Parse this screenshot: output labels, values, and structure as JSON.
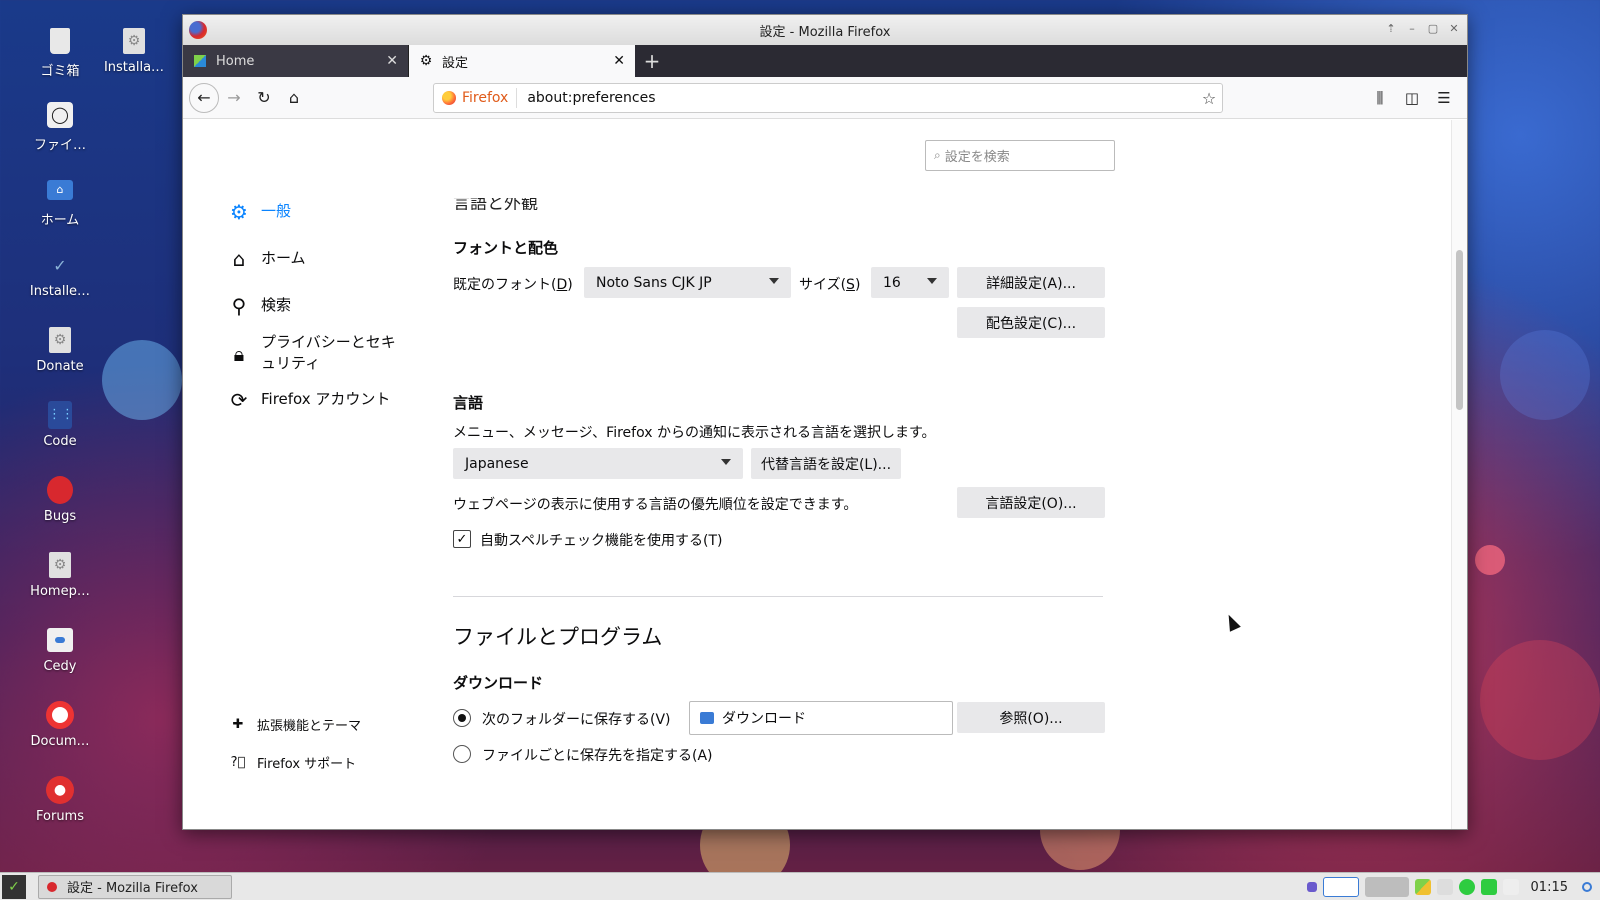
{
  "desktop": {
    "icons": [
      {
        "label": "ゴミ箱"
      },
      {
        "label": "Installa…"
      },
      {
        "label": "ファイ…"
      },
      {
        "label": "ホーム"
      },
      {
        "label": "Installe…"
      },
      {
        "label": "Donate"
      },
      {
        "label": "Code"
      },
      {
        "label": "Bugs"
      },
      {
        "label": "Homep…"
      },
      {
        "label": "Cedy"
      },
      {
        "label": "Docum…"
      },
      {
        "label": "Forums"
      }
    ]
  },
  "window": {
    "title": "設定 - Mozilla Firefox"
  },
  "tabs": [
    {
      "label": "Home",
      "close": "✕"
    },
    {
      "label": "設定",
      "close": "✕"
    }
  ],
  "newtab": "+",
  "urlbar": {
    "identity": "Firefox",
    "url": "about:preferences"
  },
  "search": {
    "placeholder": "設定を検索"
  },
  "sidebar": {
    "items": [
      {
        "label": "一般",
        "icon": "gear-icon"
      },
      {
        "label": "ホーム",
        "icon": "home-icon"
      },
      {
        "label": "検索",
        "icon": "search-icon"
      },
      {
        "label": "プライバシーとセキュリティ",
        "icon": "lock-icon"
      },
      {
        "label": "Firefox アカウント",
        "icon": "sync-icon"
      }
    ],
    "footer": [
      {
        "label": "拡張機能とテーマ",
        "icon": "puzzle-icon"
      },
      {
        "label": "Firefox サポート",
        "icon": "help-icon"
      }
    ]
  },
  "main": {
    "section_cut": "言語と外観",
    "fonts": {
      "heading": "フォントと配色",
      "default_font_label": "既定のフォント(",
      "default_font_key": "D",
      "default_font_value": "Noto Sans CJK JP",
      "size_label": "サイズ(",
      "size_key": "S",
      "size_value": "16",
      "advanced_button": "詳細設定(A)...",
      "colors_button": "配色設定(C)..."
    },
    "language": {
      "heading": "言語",
      "description": "メニュー、メッセージ、Firefox からの通知に表示される言語を選択します。",
      "language_value": "Japanese",
      "alt_button": "代替言語を設定(L)...",
      "webpage_text": "ウェブページの表示に使用する言語の優先順位を設定できます。",
      "choose_button": "言語設定(O)...",
      "spellcheck_label": "自動スペルチェック機能を使用する(T)",
      "spellcheck_checked": true
    },
    "files": {
      "heading": "ファイルとプログラム",
      "downloads_heading": "ダウンロード",
      "save_to_label": "次のフォルダーに保存する(V)",
      "folder_value": "ダウンロード",
      "browse_button": "参照(O)...",
      "ask_label": "ファイルごとに保存先を指定する(A)"
    }
  },
  "taskbar": {
    "task_label": "設定 - Mozilla Firefox",
    "clock": "01:15"
  },
  "colors": {
    "accent": "#0a84ff",
    "button_bg": "#e8e8ea"
  }
}
